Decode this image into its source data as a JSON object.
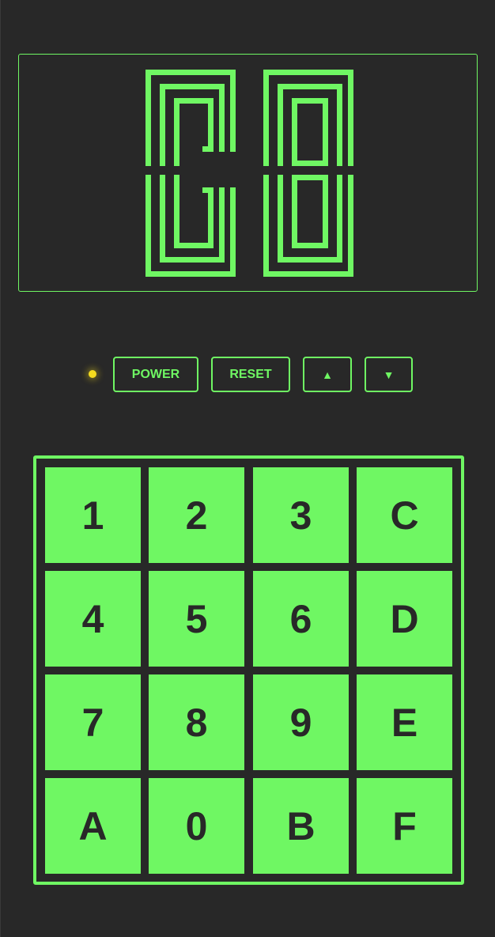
{
  "colors": {
    "background": "#282828",
    "accent": "#6ff763",
    "led": "#f5dc1e"
  },
  "display": {
    "digits": [
      "C",
      "8"
    ]
  },
  "controls": {
    "power_label": "POWER",
    "reset_label": "RESET",
    "up_label": "▲",
    "down_label": "▼",
    "led_on": true
  },
  "keypad": {
    "rows": [
      [
        "1",
        "2",
        "3",
        "C"
      ],
      [
        "4",
        "5",
        "6",
        "D"
      ],
      [
        "7",
        "8",
        "9",
        "E"
      ],
      [
        "A",
        "0",
        "B",
        "F"
      ]
    ]
  }
}
